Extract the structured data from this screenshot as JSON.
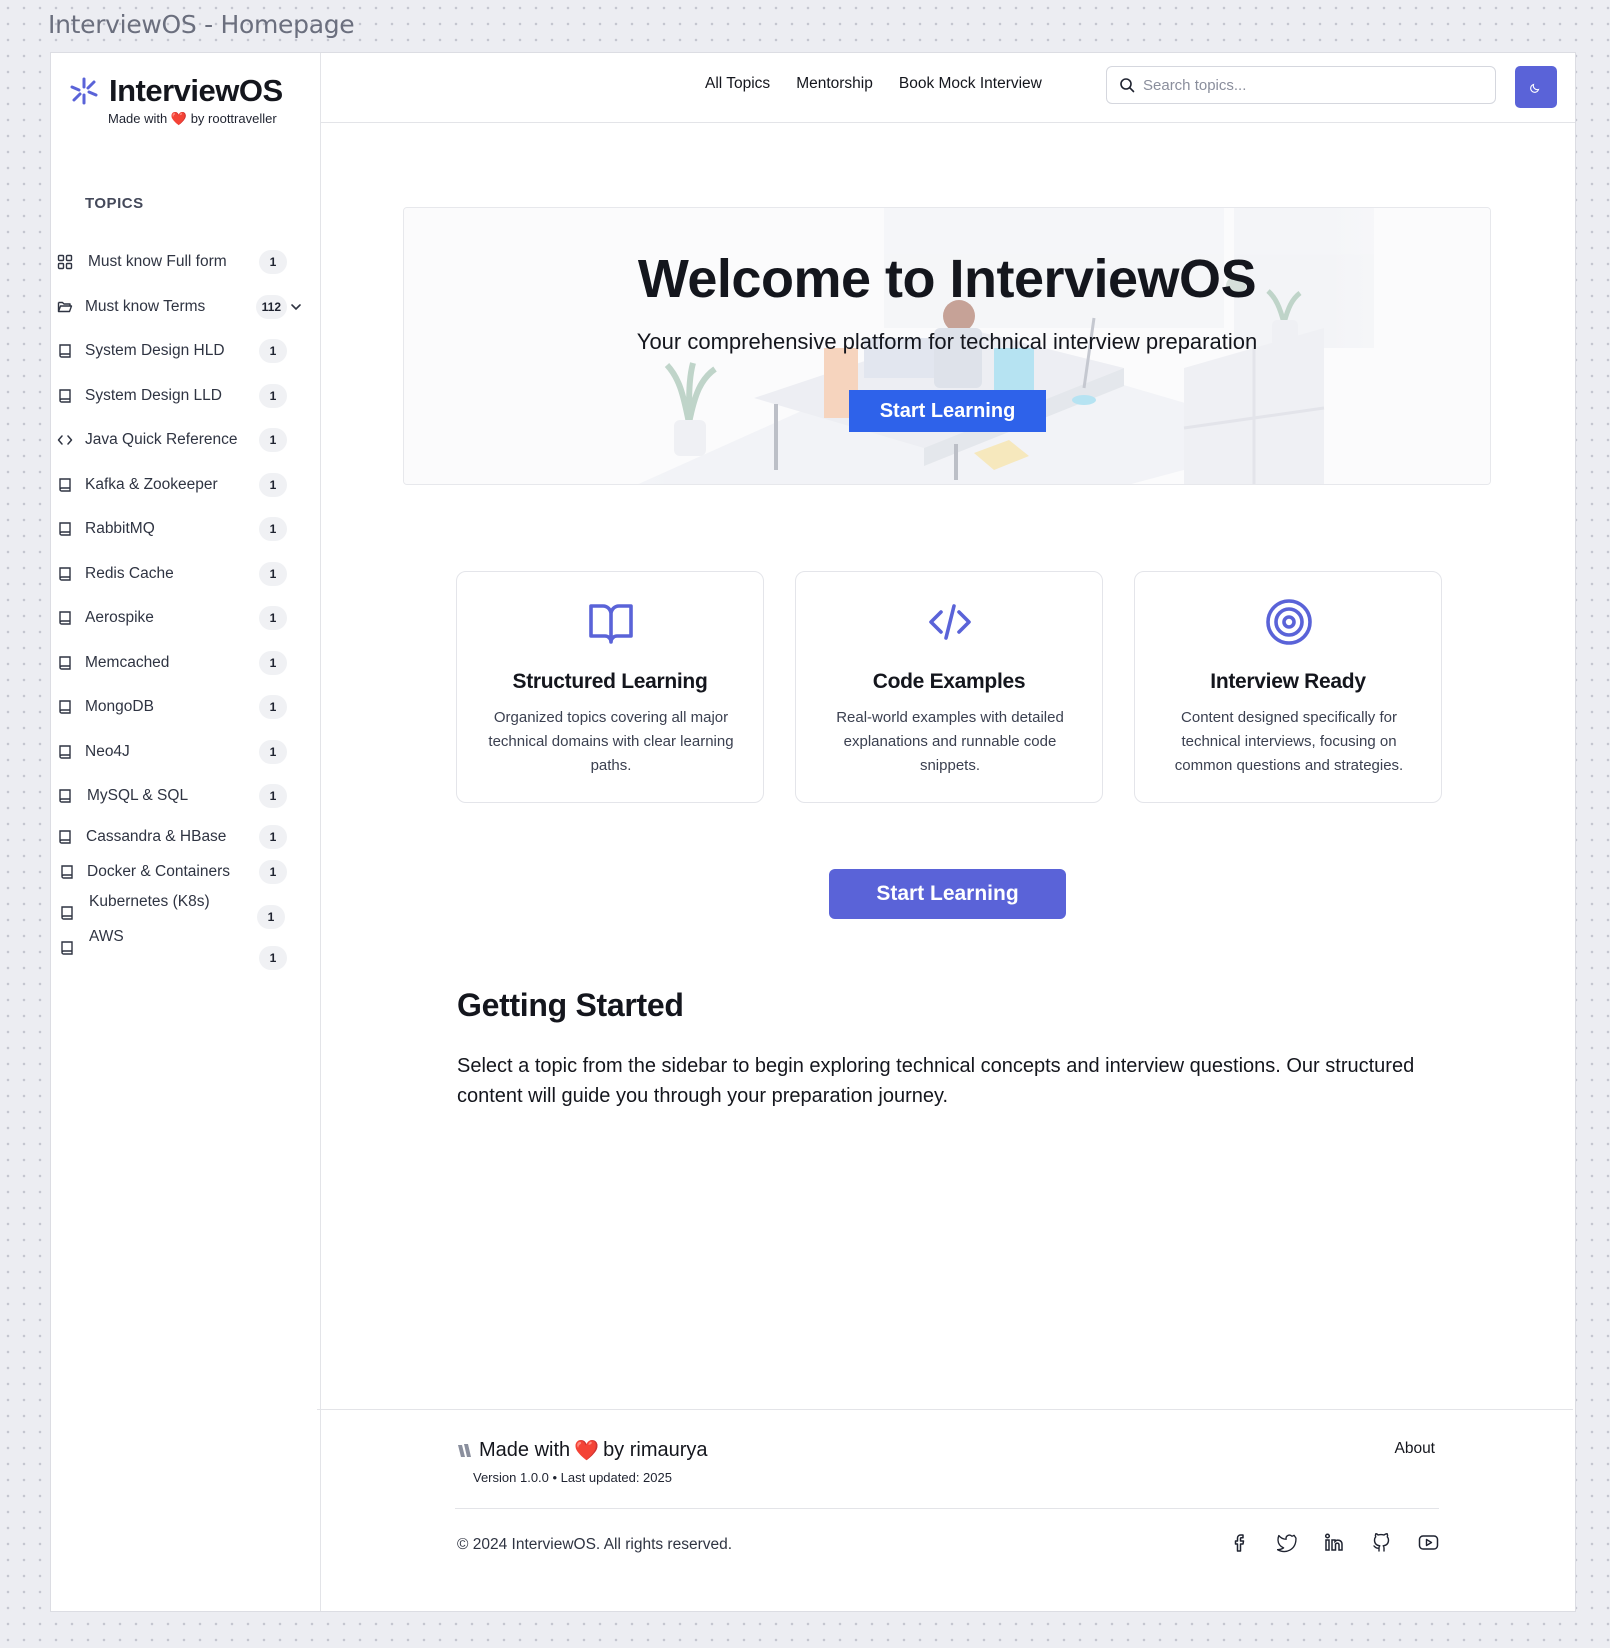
{
  "frame_title": "InterviewOS - Homepage",
  "brand": {
    "name": "InterviewOS",
    "made_with_prefix": "Made with",
    "heart": "❤️",
    "made_with_suffix": "by roottraveller"
  },
  "sidebar": {
    "section_label": "TOPICS",
    "items": [
      {
        "label": "Must know Full form",
        "count": "1",
        "icon": "grid-icon"
      },
      {
        "label": "Must know Terms",
        "count": "112",
        "icon": "folder-open-icon",
        "expandable": true
      },
      {
        "label": "System Design HLD",
        "count": "1",
        "icon": "book-icon"
      },
      {
        "label": "System Design LLD",
        "count": "1",
        "icon": "book-icon"
      },
      {
        "label": "Java Quick Reference",
        "count": "1",
        "icon": "code-icon"
      },
      {
        "label": "Kafka & Zookeeper",
        "count": "1",
        "icon": "book-icon"
      },
      {
        "label": "RabbitMQ",
        "count": "1",
        "icon": "book-icon"
      },
      {
        "label": "Redis Cache",
        "count": "1",
        "icon": "book-icon"
      },
      {
        "label": "Aerospike",
        "count": "1",
        "icon": "book-icon"
      },
      {
        "label": "Memcached",
        "count": "1",
        "icon": "book-icon"
      },
      {
        "label": "MongoDB",
        "count": "1",
        "icon": "book-icon"
      },
      {
        "label": "Neo4J",
        "count": "1",
        "icon": "book-icon"
      },
      {
        "label": "MySQL & SQL",
        "count": "1",
        "icon": "book-icon"
      },
      {
        "label": "Cassandra & HBase",
        "count": "1",
        "icon": "book-icon"
      },
      {
        "label": "Docker & Containers",
        "count": "1",
        "icon": "book-icon"
      },
      {
        "label": "Kubernetes (K8s)",
        "count": "1",
        "icon": "book-icon"
      },
      {
        "label": "AWS",
        "count": "1",
        "icon": "book-icon"
      }
    ]
  },
  "header": {
    "nav": [
      "All Topics",
      "Mentorship",
      "Book Mock Interview"
    ],
    "search_placeholder": "Search topics...",
    "search_value": "",
    "theme_toggle_icon": "moon-icon"
  },
  "hero": {
    "title": "Welcome to InterviewOS",
    "subtitle": "Your comprehensive platform for technical interview preparation",
    "button": "Start Learning"
  },
  "features": [
    {
      "icon": "open-book-icon",
      "title": "Structured Learning",
      "description": "Organized topics covering all major technical domains with clear learning paths."
    },
    {
      "icon": "code-icon",
      "title": "Code Examples",
      "description": "Real-world examples with detailed explanations and runnable code snippets."
    },
    {
      "icon": "target-icon",
      "title": "Interview Ready",
      "description": "Content designed specifically for technical interviews, focusing on common questions and strategies."
    }
  ],
  "cta_button": "Start Learning",
  "getting_started": {
    "title": "Getting Started",
    "text": "Select a topic from the sidebar to begin exploring technical concepts and interview questions. Our structured content will guide you through your preparation journey."
  },
  "footer": {
    "made_with_prefix": "Made with",
    "heart": "❤️",
    "made_with_suffix": "by rimaurya",
    "version": "Version 1.0.0 • Last updated: 2025",
    "about": "About",
    "copyright": "© 2024 InterviewOS. All rights reserved.",
    "socials": [
      "facebook-icon",
      "twitter-icon",
      "linkedin-icon",
      "github-icon",
      "youtube-icon"
    ]
  },
  "colors": {
    "accent": "#5a63d8",
    "hero_button": "#2e62ea",
    "heart": "#e0352b",
    "background": "#ecedf2"
  }
}
